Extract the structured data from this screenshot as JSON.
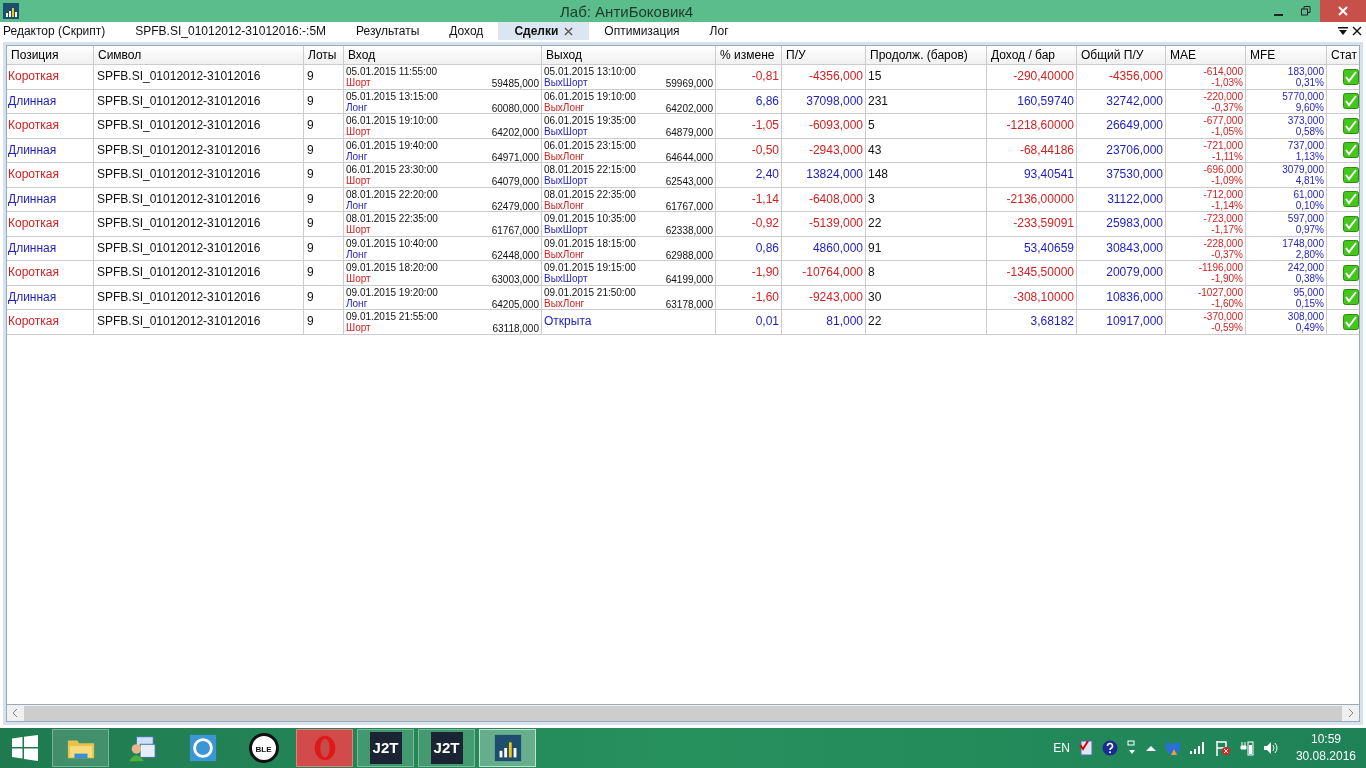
{
  "window": {
    "title": "Лаб: АнтиБоковик4"
  },
  "tabs": [
    {
      "label": "Редактор (Скрипт)",
      "selected": false
    },
    {
      "label": "SPFB.SI_01012012-31012016:-:5M",
      "selected": false
    },
    {
      "label": "Результаты",
      "selected": false
    },
    {
      "label": "Доход",
      "selected": false
    },
    {
      "label": "Сделки",
      "selected": true
    },
    {
      "label": "Оптимизация",
      "selected": false
    },
    {
      "label": "Лог",
      "selected": false
    }
  ],
  "table": {
    "columns": [
      "Позиция",
      "Символ",
      "Лоты",
      "Вход",
      "Выход",
      "% измене",
      "П/У",
      "Продолж. (баров)",
      "Доход / бар",
      "Общий П/У",
      "MAE",
      "MFE",
      "Стат"
    ],
    "rows": [
      {
        "kind": "short",
        "position": "Короткая",
        "symbol": "SPFB.SI_01012012-31012016",
        "lots": "9",
        "entry_time": "05.01.2015 11:55:00",
        "entry_signal": "Шорт",
        "entry_price": "59485,000",
        "exit_time": "05.01.2015 13:10:00",
        "exit_signal": "ВыхШорт",
        "exit_price": "59969,000",
        "loss": true,
        "pct": "-0,81",
        "pnl": "-4356,000",
        "bars": "15",
        "per_bar": "-290,40000",
        "total_loss": true,
        "total": "-4356,000",
        "mae": "-614,000",
        "mae_pct": "-1,03%",
        "mfe": "183,000",
        "mfe_pct": "0,31%",
        "ok": true
      },
      {
        "kind": "long",
        "position": "Длинная",
        "symbol": "SPFB.SI_01012012-31012016",
        "lots": "9",
        "entry_time": "05.01.2015 13:15:00",
        "entry_signal": "Лонг",
        "entry_price": "60080,000",
        "exit_time": "06.01.2015 19:10:00",
        "exit_signal": "ВыхЛонг",
        "exit_price": "64202,000",
        "loss": false,
        "pct": "6,86",
        "pnl": "37098,000",
        "bars": "231",
        "per_bar": "160,59740",
        "total_loss": false,
        "total": "32742,000",
        "mae": "-220,000",
        "mae_pct": "-0,37%",
        "mfe": "5770,000",
        "mfe_pct": "9,60%",
        "ok": true
      },
      {
        "kind": "short",
        "position": "Короткая",
        "symbol": "SPFB.SI_01012012-31012016",
        "lots": "9",
        "entry_time": "06.01.2015 19:10:00",
        "entry_signal": "Шорт",
        "entry_price": "64202,000",
        "exit_time": "06.01.2015 19:35:00",
        "exit_signal": "ВыхШорт",
        "exit_price": "64879,000",
        "loss": true,
        "pct": "-1,05",
        "pnl": "-6093,000",
        "bars": "5",
        "per_bar": "-1218,60000",
        "total_loss": false,
        "total": "26649,000",
        "mae": "-677,000",
        "mae_pct": "-1,05%",
        "mfe": "373,000",
        "mfe_pct": "0,58%",
        "ok": true
      },
      {
        "kind": "long",
        "position": "Длинная",
        "symbol": "SPFB.SI_01012012-31012016",
        "lots": "9",
        "entry_time": "06.01.2015 19:40:00",
        "entry_signal": "Лонг",
        "entry_price": "64971,000",
        "exit_time": "06.01.2015 23:15:00",
        "exit_signal": "ВыхЛонг",
        "exit_price": "64644,000",
        "loss": true,
        "pct": "-0,50",
        "pnl": "-2943,000",
        "bars": "43",
        "per_bar": "-68,44186",
        "total_loss": false,
        "total": "23706,000",
        "mae": "-721,000",
        "mae_pct": "-1,11%",
        "mfe": "737,000",
        "mfe_pct": "1,13%",
        "ok": true
      },
      {
        "kind": "short",
        "position": "Короткая",
        "symbol": "SPFB.SI_01012012-31012016",
        "lots": "9",
        "entry_time": "06.01.2015 23:30:00",
        "entry_signal": "Шорт",
        "entry_price": "64079,000",
        "exit_time": "08.01.2015 22:15:00",
        "exit_signal": "ВыхШорт",
        "exit_price": "62543,000",
        "loss": false,
        "pct": "2,40",
        "pnl": "13824,000",
        "bars": "148",
        "per_bar": "93,40541",
        "total_loss": false,
        "total": "37530,000",
        "mae": "-696,000",
        "mae_pct": "-1,09%",
        "mfe": "3079,000",
        "mfe_pct": "4,81%",
        "ok": true
      },
      {
        "kind": "long",
        "position": "Длинная",
        "symbol": "SPFB.SI_01012012-31012016",
        "lots": "9",
        "entry_time": "08.01.2015 22:20:00",
        "entry_signal": "Лонг",
        "entry_price": "62479,000",
        "exit_time": "08.01.2015 22:35:00",
        "exit_signal": "ВыхЛонг",
        "exit_price": "61767,000",
        "loss": true,
        "pct": "-1,14",
        "pnl": "-6408,000",
        "bars": "3",
        "per_bar": "-2136,00000",
        "total_loss": false,
        "total": "31122,000",
        "mae": "-712,000",
        "mae_pct": "-1,14%",
        "mfe": "61,000",
        "mfe_pct": "0,10%",
        "ok": true
      },
      {
        "kind": "short",
        "position": "Короткая",
        "symbol": "SPFB.SI_01012012-31012016",
        "lots": "9",
        "entry_time": "08.01.2015 22:35:00",
        "entry_signal": "Шорт",
        "entry_price": "61767,000",
        "exit_time": "09.01.2015 10:35:00",
        "exit_signal": "ВыхШорт",
        "exit_price": "62338,000",
        "loss": true,
        "pct": "-0,92",
        "pnl": "-5139,000",
        "bars": "22",
        "per_bar": "-233,59091",
        "total_loss": false,
        "total": "25983,000",
        "mae": "-723,000",
        "mae_pct": "-1,17%",
        "mfe": "597,000",
        "mfe_pct": "0,97%",
        "ok": true
      },
      {
        "kind": "long",
        "position": "Длинная",
        "symbol": "SPFB.SI_01012012-31012016",
        "lots": "9",
        "entry_time": "09.01.2015 10:40:00",
        "entry_signal": "Лонг",
        "entry_price": "62448,000",
        "exit_time": "09.01.2015 18:15:00",
        "exit_signal": "ВыхЛонг",
        "exit_price": "62988,000",
        "loss": false,
        "pct": "0,86",
        "pnl": "4860,000",
        "bars": "91",
        "per_bar": "53,40659",
        "total_loss": false,
        "total": "30843,000",
        "mae": "-228,000",
        "mae_pct": "-0,37%",
        "mfe": "1748,000",
        "mfe_pct": "2,80%",
        "ok": true
      },
      {
        "kind": "short",
        "position": "Короткая",
        "symbol": "SPFB.SI_01012012-31012016",
        "lots": "9",
        "entry_time": "09.01.2015 18:20:00",
        "entry_signal": "Шорт",
        "entry_price": "63003,000",
        "exit_time": "09.01.2015 19:15:00",
        "exit_signal": "ВыхШорт",
        "exit_price": "64199,000",
        "loss": true,
        "pct": "-1,90",
        "pnl": "-10764,000",
        "bars": "8",
        "per_bar": "-1345,50000",
        "total_loss": false,
        "total": "20079,000",
        "mae": "-1196,000",
        "mae_pct": "-1,90%",
        "mfe": "242,000",
        "mfe_pct": "0,38%",
        "ok": true
      },
      {
        "kind": "long",
        "position": "Длинная",
        "symbol": "SPFB.SI_01012012-31012016",
        "lots": "9",
        "entry_time": "09.01.2015 19:20:00",
        "entry_signal": "Лонг",
        "entry_price": "64205,000",
        "exit_time": "09.01.2015 21:50:00",
        "exit_signal": "ВыхЛонг",
        "exit_price": "63178,000",
        "loss": true,
        "pct": "-1,60",
        "pnl": "-9243,000",
        "bars": "30",
        "per_bar": "-308,10000",
        "total_loss": false,
        "total": "10836,000",
        "mae": "-1027,000",
        "mae_pct": "-1,60%",
        "mfe": "95,000",
        "mfe_pct": "0,15%",
        "ok": true
      },
      {
        "kind": "short",
        "position": "Короткая",
        "symbol": "SPFB.SI_01012012-31012016",
        "lots": "9",
        "entry_time": "09.01.2015 21:55:00",
        "entry_signal": "Шорт",
        "entry_price": "63118,000",
        "exit_status": "Открыта",
        "loss": false,
        "pct": "0,01",
        "pnl": "81,000",
        "bars": "22",
        "per_bar": "3,68182",
        "total_loss": false,
        "total": "10917,000",
        "mae": "-370,000",
        "mae_pct": "-0,59%",
        "mfe": "308,000",
        "mfe_pct": "0,49%",
        "ok": true
      }
    ]
  },
  "taskbar": {
    "items": [
      {
        "kind": "folder",
        "running": true,
        "selected": false
      },
      {
        "kind": "people",
        "running": false,
        "selected": false
      },
      {
        "kind": "circle",
        "running": false,
        "selected": false
      },
      {
        "kind": "ble",
        "label": "BLE",
        "running": false,
        "selected": false
      },
      {
        "kind": "opera",
        "running": true,
        "selected": false
      },
      {
        "kind": "j2t",
        "label": "J2T",
        "running": true,
        "selected": false
      },
      {
        "kind": "j2t",
        "label": "J2T",
        "running": true,
        "selected": false
      },
      {
        "kind": "chart",
        "running": true,
        "selected": true
      }
    ],
    "language": "EN",
    "time": "10:59",
    "date": "30.08.2016"
  }
}
